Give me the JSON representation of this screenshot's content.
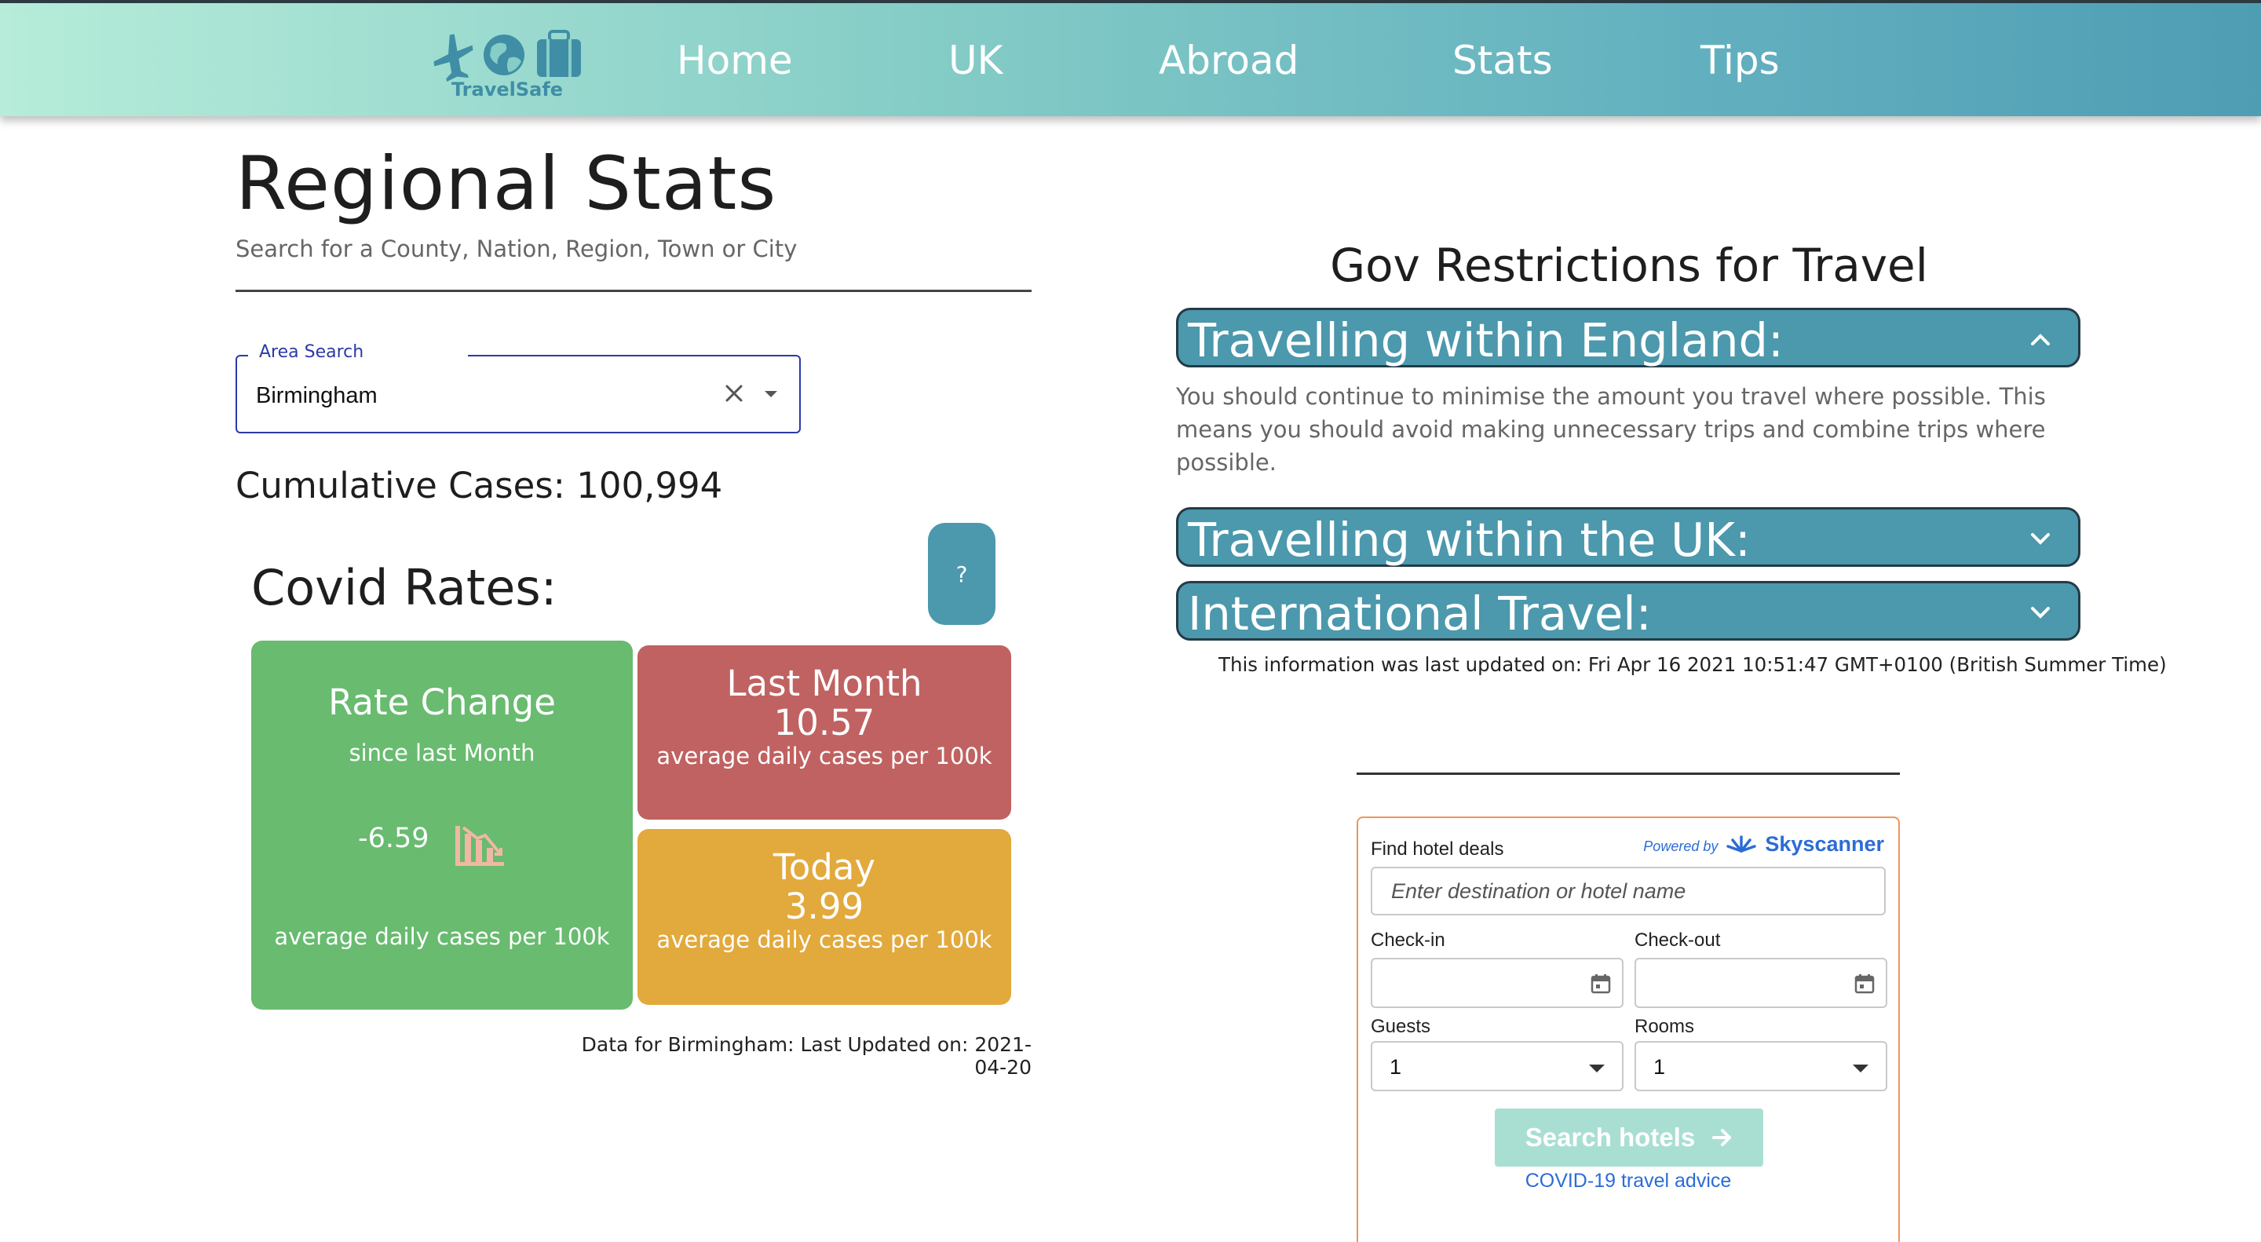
{
  "nav": {
    "brand": "TravelSafe",
    "links": [
      "Home",
      "UK",
      "Abroad",
      "Stats",
      "Tips"
    ],
    "colors": {
      "accent": "#4c98ad",
      "gradient_start": "#b6ecd9",
      "gradient_end": "#4f9db3"
    }
  },
  "regional": {
    "title": "Regional Stats",
    "subtitle": "Search for a County, Nation, Region, Town or City",
    "search": {
      "label": "Area Search",
      "value": "Birmingham"
    },
    "cumulative_label": "Cumulative Cases:",
    "cumulative_value": "100,994",
    "rates_title": "Covid Rates:",
    "help_label": "?",
    "cards": {
      "rate_change": {
        "title": "Rate Change",
        "subtitle": "since last Month",
        "value": "-6.59",
        "unit": "average daily cases per 100k",
        "icon": "trending-down-chart-icon",
        "color": "#68bb6f"
      },
      "last_month": {
        "title": "Last Month",
        "value": "10.57",
        "unit": "average daily cases per 100k",
        "color": "#c06261"
      },
      "today": {
        "title": "Today",
        "value": "3.99",
        "unit": "average daily cases per 100k",
        "color": "#e2a93c"
      }
    },
    "footnote": "Data for Birmingham: Last Updated on: 2021-04-20"
  },
  "gov": {
    "title": "Gov Restrictions for Travel",
    "sections": [
      {
        "label": "Travelling within England:",
        "expanded": true,
        "body": "You should continue to minimise the amount you travel where possible. This means you should avoid making unnecessary trips and combine trips where possible."
      },
      {
        "label": "Travelling within the UK:",
        "expanded": false
      },
      {
        "label": "International Travel:",
        "expanded": false
      }
    ],
    "updated": "This information was last updated on: Fri Apr 16 2021 10:51:47 GMT+0100 (British Summer Time)"
  },
  "hotel": {
    "title": "Find hotel deals",
    "powered_by": "Powered by",
    "brand": "Skyscanner",
    "destination_placeholder": "Enter destination or hotel name",
    "checkin_label": "Check-in",
    "checkout_label": "Check-out",
    "guests_label": "Guests",
    "guests_value": "1",
    "rooms_label": "Rooms",
    "rooms_value": "1",
    "search_label": "Search hotels",
    "covid_link": "COVID-19 travel advice",
    "colors": {
      "border": "#f0955a",
      "button": "#a9dfd2",
      "link": "#2c6cd6"
    }
  }
}
